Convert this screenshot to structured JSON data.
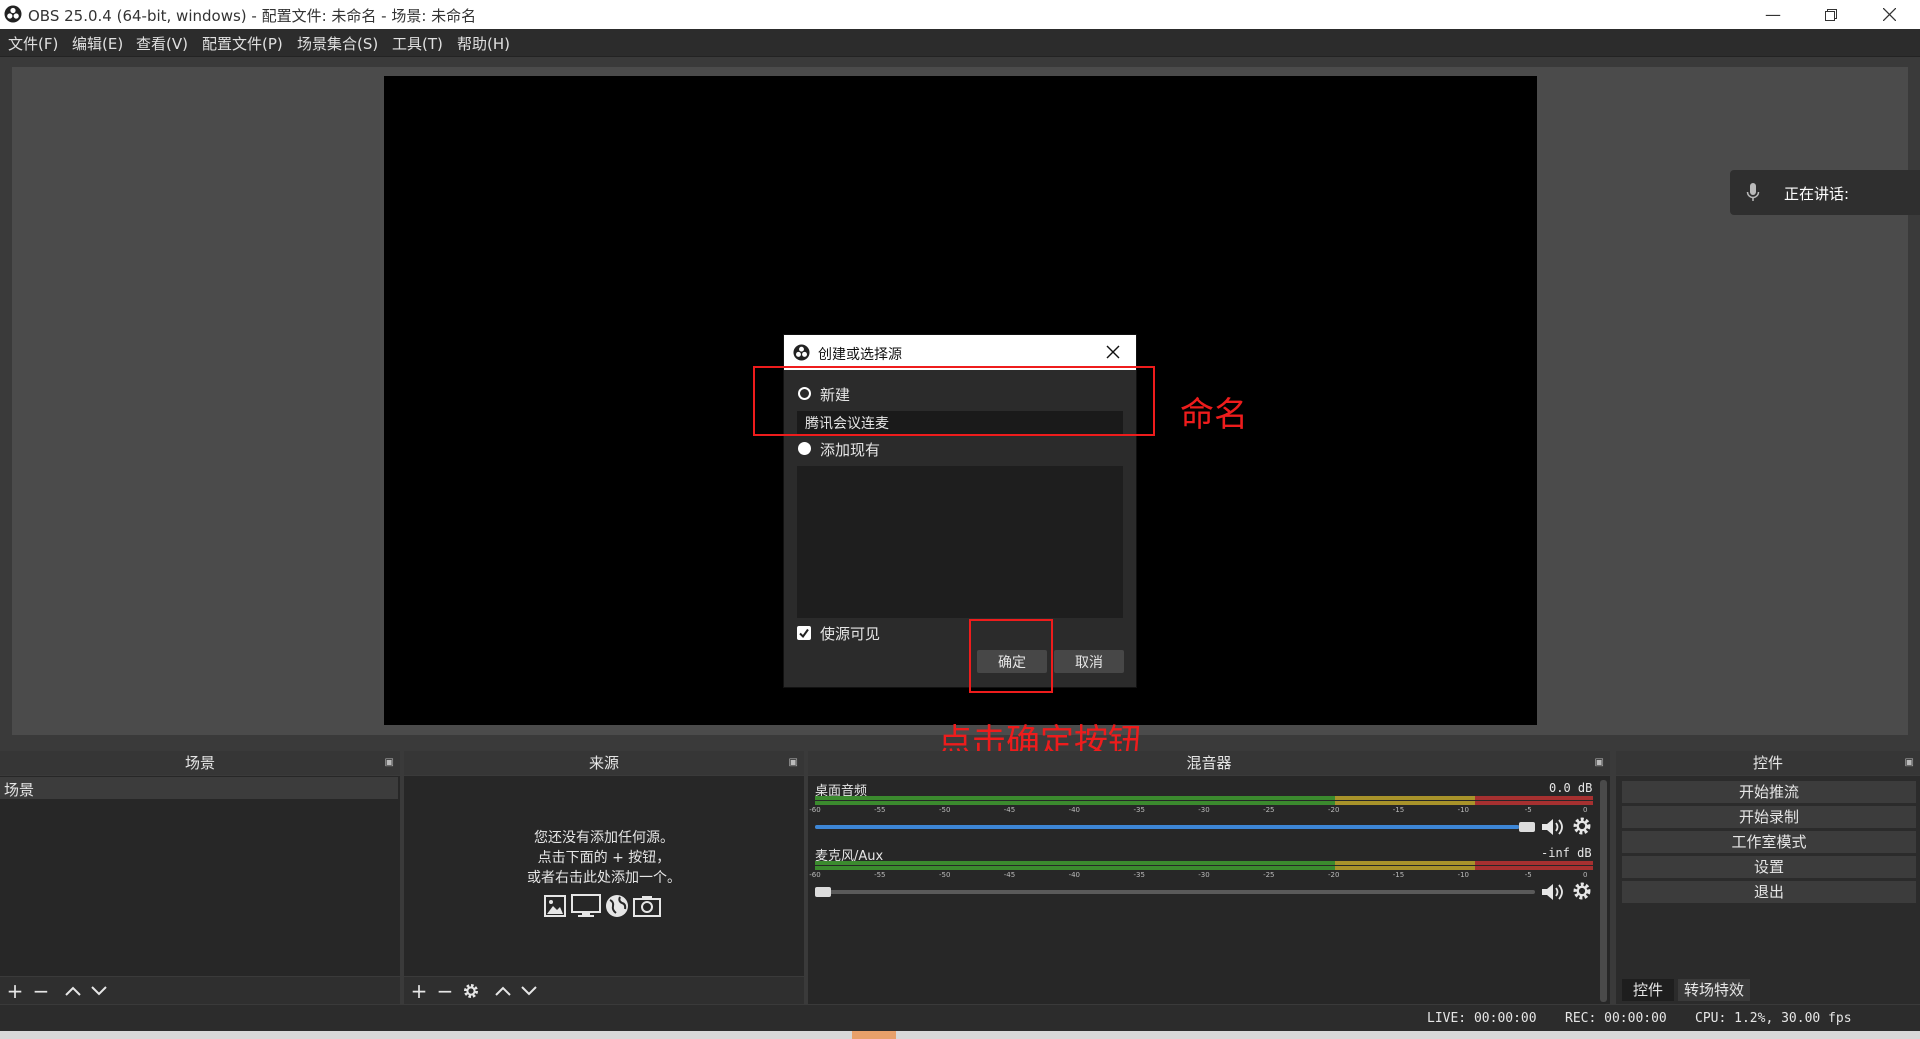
{
  "window": {
    "title": "OBS 25.0.4 (64-bit, windows) - 配置文件: 未命名 - 场景: 未命名"
  },
  "menu": [
    "文件(F)",
    "编辑(E)",
    "查看(V)",
    "配置文件(P)",
    "场景集合(S)",
    "工具(T)",
    "帮助(H)"
  ],
  "speaking": {
    "label": "正在讲话:"
  },
  "dialog": {
    "title": "创建或选择源",
    "new_label": "新建",
    "name_value": "腾讯会议连麦",
    "existing_label": "添加现有",
    "visible_label": "使源可见",
    "ok": "确定",
    "cancel": "取消",
    "new_selected": false,
    "visible_checked": true
  },
  "annotations": {
    "name_hint": "命名",
    "click_hint": "点击确定按钮"
  },
  "docks": {
    "scenes": {
      "title": "场景",
      "items": [
        "场景"
      ]
    },
    "sources": {
      "title": "来源",
      "empty_lines": [
        "您还没有添加任何源。",
        "点击下面的 + 按钮，",
        "或者右击此处添加一个。"
      ]
    },
    "mixer": {
      "title": "混音器",
      "ticks": [
        "-60",
        "-55",
        "-50",
        "-45",
        "-40",
        "-35",
        "-30",
        "-25",
        "-20",
        "-15",
        "-10",
        "-5",
        "0"
      ],
      "tracks": [
        {
          "name": "桌面音频",
          "level": "0.0 dB",
          "volume": 1.0
        },
        {
          "name": "麦克风/Aux",
          "level": "-inf dB",
          "volume": 0.0
        }
      ]
    },
    "controls": {
      "title": "控件",
      "buttons": [
        "开始推流",
        "开始录制",
        "工作室模式",
        "设置",
        "退出"
      ],
      "tabs": [
        "控件",
        "转场特效"
      ]
    }
  },
  "status": {
    "live": "LIVE: 00:00:00",
    "rec": "REC: 00:00:00",
    "cpu": "CPU: 1.2%, 30.00 fps"
  },
  "colors": {
    "annotation": "#ee1c1c",
    "meter_green": "#3b8a2e",
    "meter_yellow": "#a8932a",
    "meter_red": "#a63030",
    "volume_blue": "#3d86d6"
  }
}
